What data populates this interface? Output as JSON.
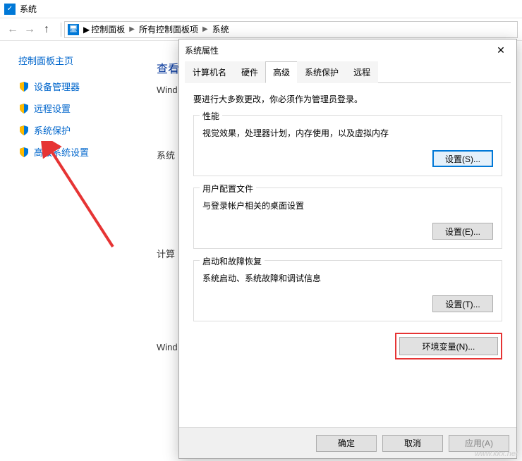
{
  "window": {
    "title": "系统"
  },
  "breadcrumb": {
    "seg1": "控制面板",
    "seg2": "所有控制面板项",
    "seg3": "系统"
  },
  "sidebar": {
    "home": "控制面板主页",
    "items": [
      {
        "label": "设备管理器"
      },
      {
        "label": "远程设置"
      },
      {
        "label": "系统保护"
      },
      {
        "label": "高级系统设置"
      }
    ]
  },
  "background": {
    "heading": "查看",
    "line1": "Wind",
    "line2": "系统",
    "line3": "计算",
    "line4": "Wind"
  },
  "dialog": {
    "title": "系统属性",
    "tabs": {
      "t1": "计算机名",
      "t2": "硬件",
      "t3": "高级",
      "t4": "系统保护",
      "t5": "远程"
    },
    "admin_note": "要进行大多数更改，你必须作为管理员登录。",
    "perf": {
      "label": "性能",
      "desc": "视觉效果，处理器计划，内存使用，以及虚拟内存",
      "btn": "设置(S)..."
    },
    "profile": {
      "label": "用户配置文件",
      "desc": "与登录帐户相关的桌面设置",
      "btn": "设置(E)..."
    },
    "startup": {
      "label": "启动和故障恢复",
      "desc": "系统启动、系统故障和调试信息",
      "btn": "设置(T)..."
    },
    "env_btn": "环境变量(N)...",
    "ok": "确定",
    "cancel": "取消",
    "apply": "应用(A)"
  },
  "watermark": "www.kkx.net"
}
